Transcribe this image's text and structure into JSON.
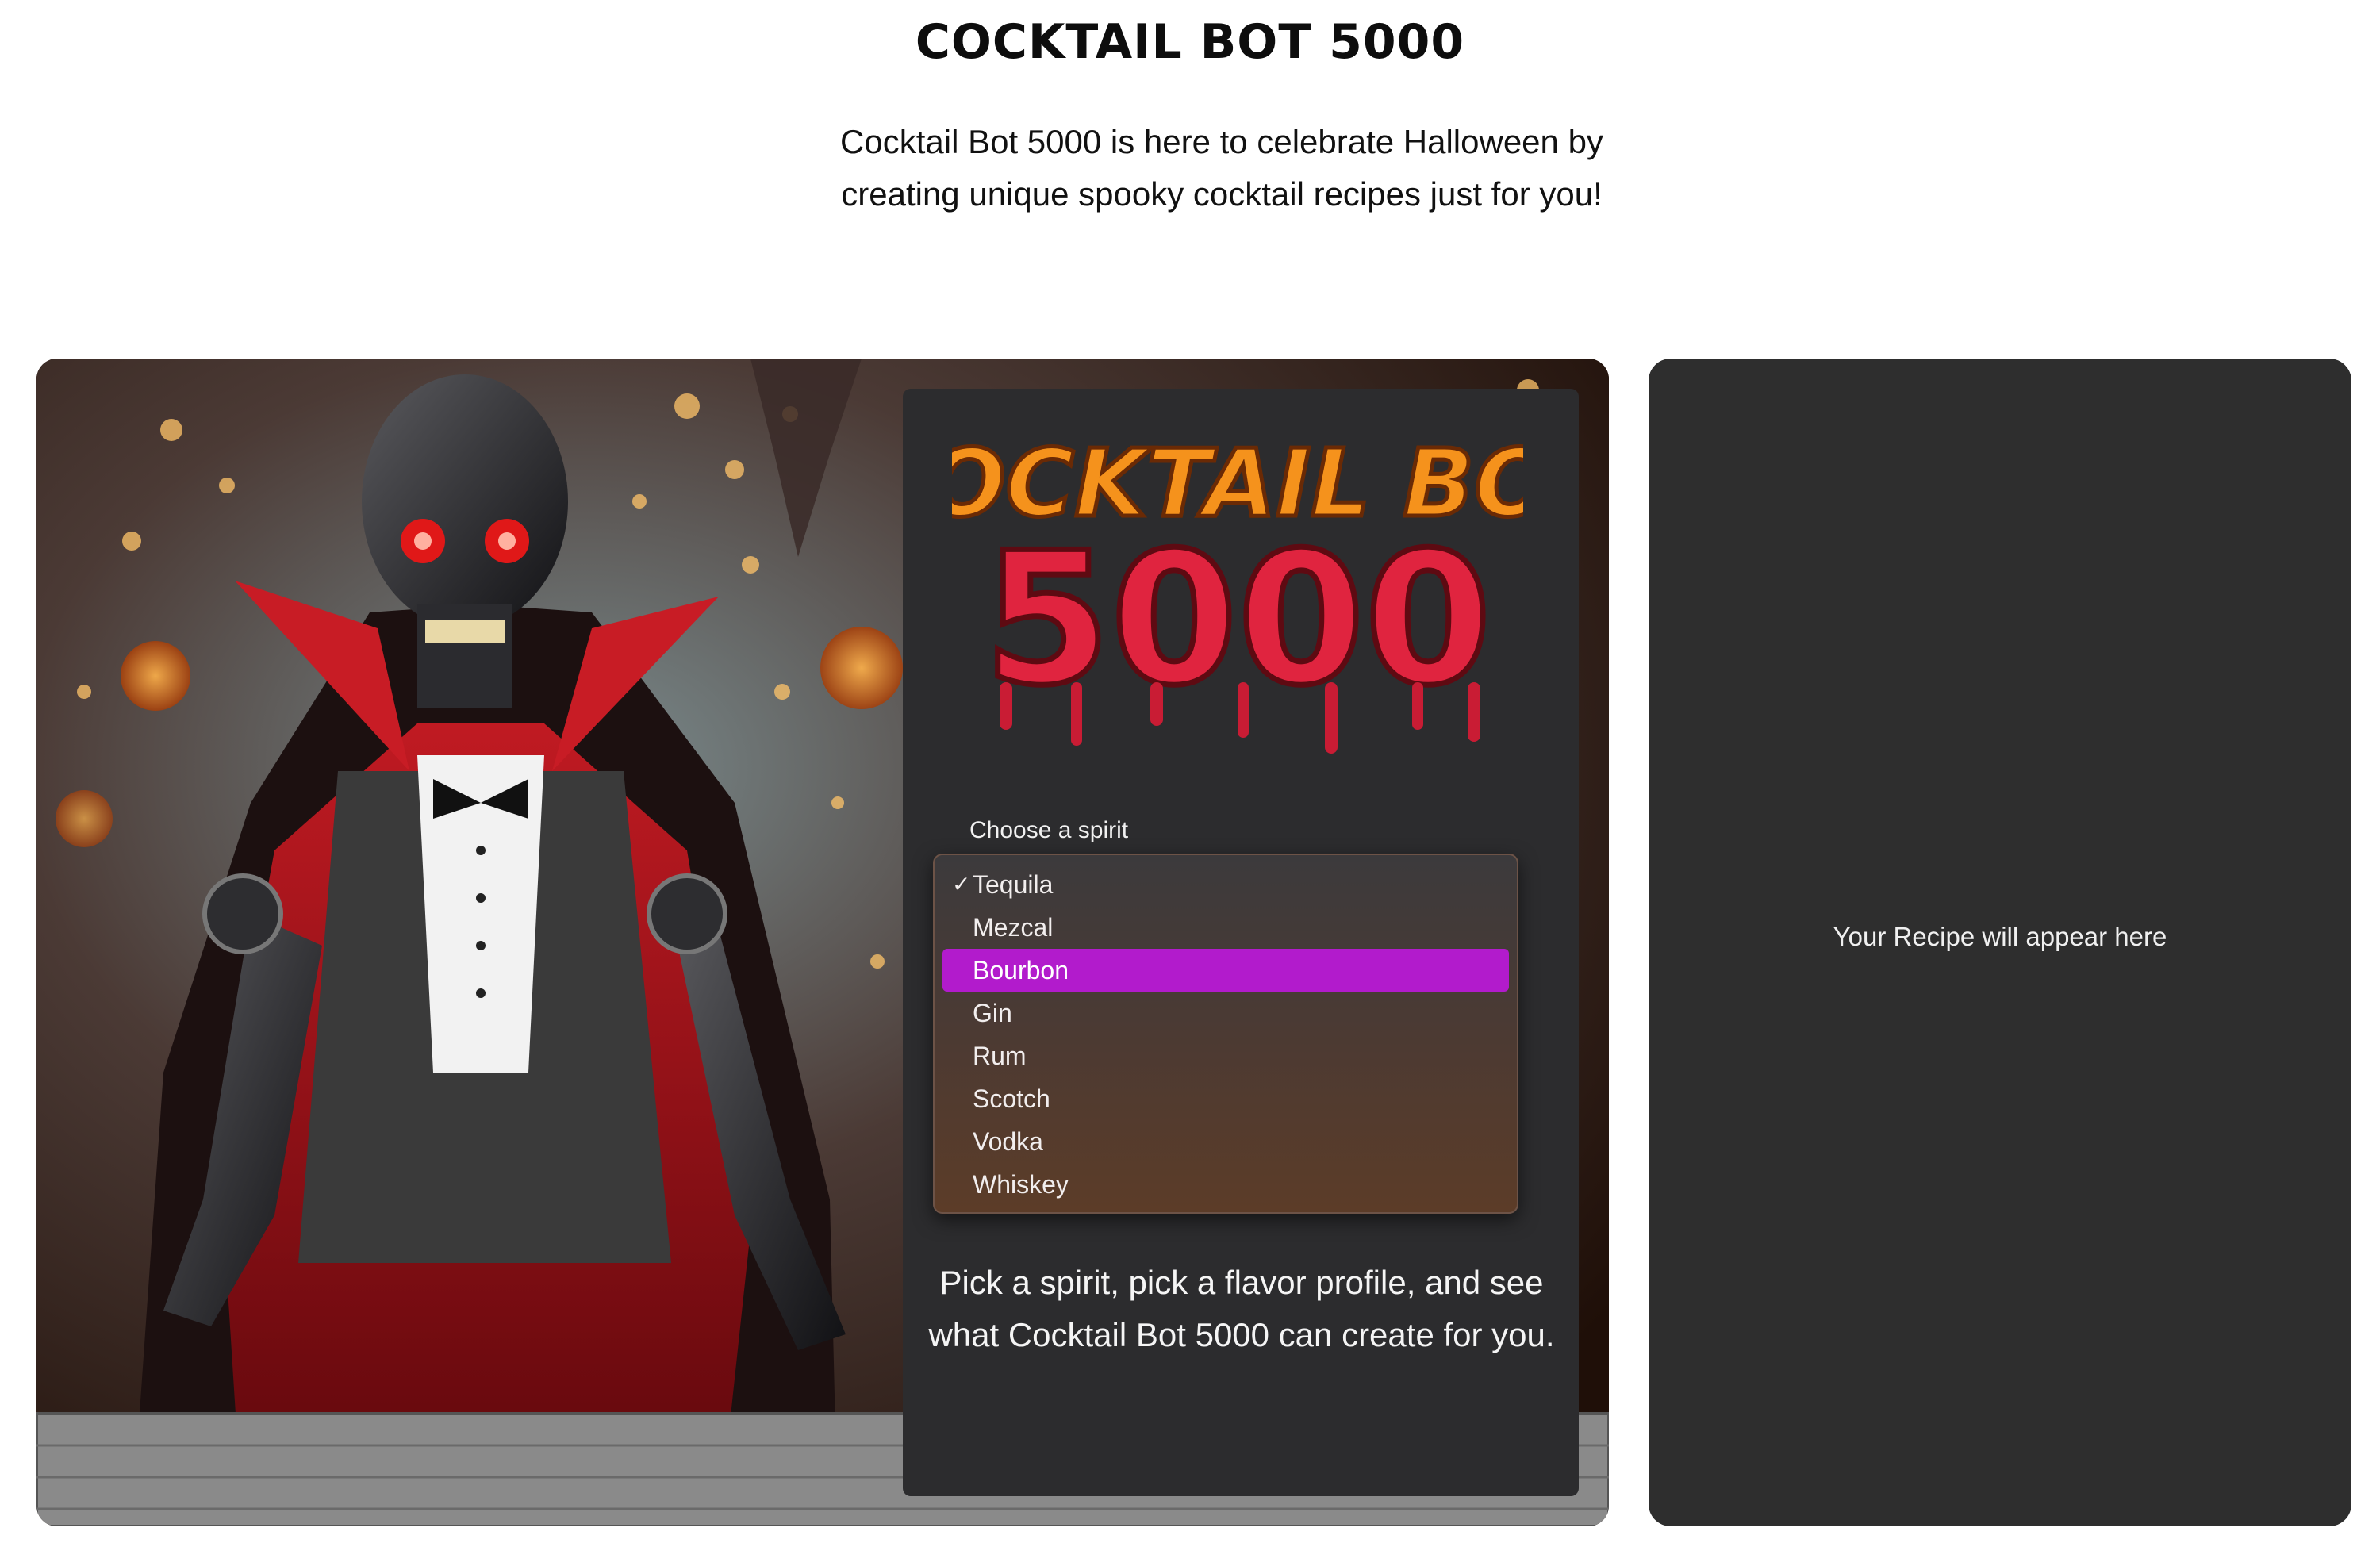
{
  "page": {
    "title": "COCKTAIL BOT 5000",
    "intro": "Cocktail Bot 5000 is here to celebrate Halloween by creating unique spooky cocktail recipes just for you!"
  },
  "hero": {
    "image_alt": "robot-vampire-bartender",
    "logo": {
      "line1": "COCKTAIL BOT",
      "line2": "5000"
    }
  },
  "form": {
    "spirit_label": "Choose a spirit",
    "spirit_options": [
      {
        "label": "Tequila",
        "checked": true
      },
      {
        "label": "Mezcal"
      },
      {
        "label": "Bourbon",
        "highlighted": true
      },
      {
        "label": "Gin"
      },
      {
        "label": "Rum"
      },
      {
        "label": "Scotch"
      },
      {
        "label": "Vodka"
      },
      {
        "label": "Whiskey"
      }
    ],
    "check_mark": "✓",
    "tagline": "Pick a spirit, pick a flavor profile, and see what Cocktail Bot 5000 can create for you."
  },
  "recipe": {
    "placeholder": "Your Recipe will appear here"
  },
  "colors": {
    "accent_orange": "#f0821e",
    "highlight_purple": "#b21bcc",
    "panel_dark": "#2c2c2e",
    "logo_orange": "#f5921c",
    "logo_red": "#e0243f"
  }
}
